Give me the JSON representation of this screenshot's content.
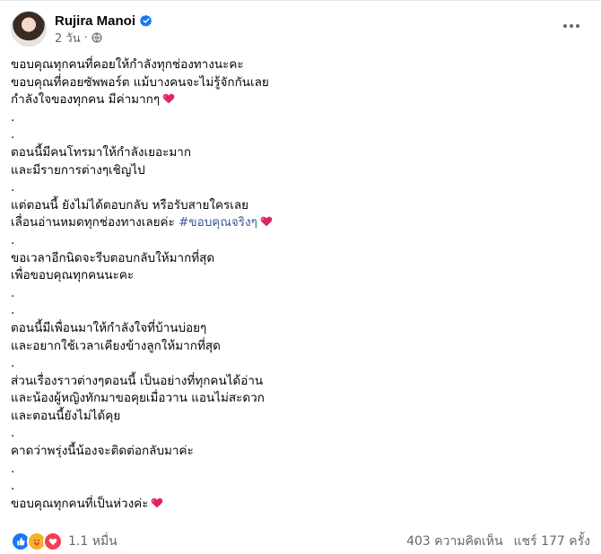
{
  "post": {
    "author": "Rujira Manoi",
    "time": "2 วัน",
    "privacy_icon": "globe-icon",
    "verified_icon": "verified-badge-icon",
    "accent_color": "#1877f2",
    "hashtag_color": "#385898"
  },
  "body": {
    "lines": [
      {
        "text": "ขอบคุณทุกคนที่คอยให้กำลังทุกช่องทางนะคะ"
      },
      {
        "text": "ขอบคุณที่คอยซัพพอร์ต แม้บางคนจะไม่รู้จักกันเลย"
      },
      {
        "text": "กำลังใจของทุกคน มีค่ามากๆ",
        "heart": true
      },
      {
        "text": "."
      },
      {
        "text": "."
      },
      {
        "text": "ตอนนี้มีคนโทรมาให้กำลังเยอะมาก"
      },
      {
        "text": "และมีรายการต่างๆเชิญไป"
      },
      {
        "text": "."
      },
      {
        "text": "แต่ตอนนี้ ยังไม่ได้ตอบกลับ หรือรับสายใครเลย"
      },
      {
        "text": "เลื่อนอ่านหมดทุกช่องทางเลยค่ะ",
        "hashtag": "#ขอบคุณจริงๆ",
        "heart": true
      },
      {
        "text": "."
      },
      {
        "text": "ขอเวลาอีกนิดจะรีบตอบกลับให้มากที่สุด"
      },
      {
        "text": "เพื่อขอบคุณทุกคนนะคะ"
      },
      {
        "text": "."
      },
      {
        "text": "."
      },
      {
        "text": "ตอนนี้มีเพื่อนมาให้กำลังใจที่บ้านบ่อยๆ"
      },
      {
        "text": "และอยากใช้เวลาเคียงข้างลูกให้มากที่สุด"
      },
      {
        "text": "."
      },
      {
        "text": "ส่วนเรื่องราวต่างๆตอนนี้ เป็นอย่างที่ทุกคนได้อ่าน"
      },
      {
        "text": "และน้องผู้หญิงทักมาขอคุยเมื่อวาน แอนไม่สะดวก"
      },
      {
        "text": "และตอนนี้ยังไม่ได้คุย"
      },
      {
        "text": "."
      },
      {
        "text": "คาดว่าพรุ่งนี้น้องจะติดต่อกลับมาค่ะ"
      },
      {
        "text": "."
      },
      {
        "text": "."
      },
      {
        "text": "ขอบคุณทุกคนที่เป็นห่วงค่ะ",
        "heart": true
      }
    ]
  },
  "footer": {
    "reaction_count": "1.1 หมื่น",
    "reactions": [
      "like",
      "care",
      "love"
    ],
    "comments": "403 ความคิดเห็น",
    "shares": "แชร์ 177 ครั้ง"
  }
}
